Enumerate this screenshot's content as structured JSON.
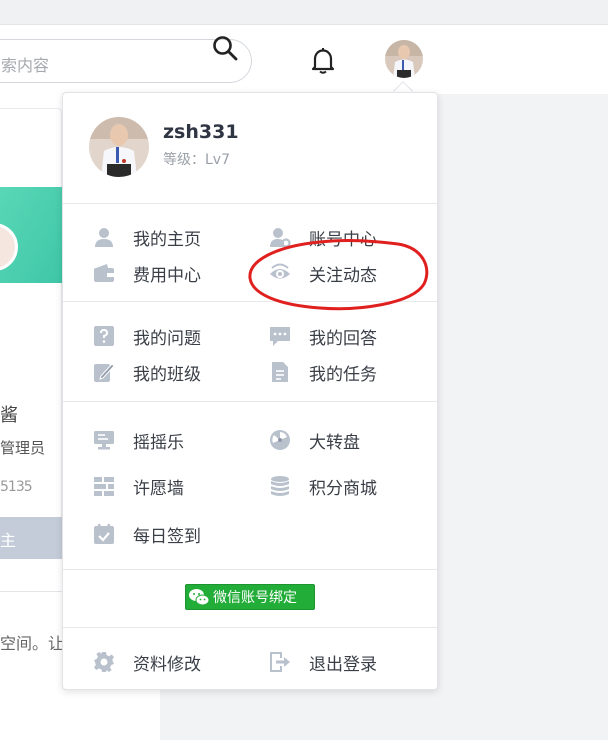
{
  "header": {
    "search_placeholder": "索内容"
  },
  "left_card": {
    "name_partial": "酱",
    "role_partial": "管理员",
    "stat_partial": "5135",
    "button_partial": "主",
    "text_partial": "空间。让"
  },
  "dropdown": {
    "username": "zsh331",
    "level": "等级：Lv7",
    "section1": {
      "my_home": "我的主页",
      "account_center": "账号中心",
      "billing_center": "费用中心",
      "follow_feed": "关注动态"
    },
    "section2": {
      "my_questions": "我的问题",
      "my_answers": "我的回答",
      "my_classes": "我的班级",
      "my_tasks": "我的任务"
    },
    "section3": {
      "shake": "摇摇乐",
      "wheel": "大转盘",
      "wish_wall": "许愿墙",
      "points_mall": "积分商城",
      "daily_checkin": "每日签到"
    },
    "wechat_bind": "微信账号绑定",
    "section4": {
      "edit_profile": "资料修改",
      "logout": "退出登录"
    }
  },
  "colors": {
    "icon_gray": "#b9c1cd",
    "annotation_red": "#e0201e",
    "wechat_green": "#22ac38",
    "card_teal": "#4fd1b0"
  }
}
